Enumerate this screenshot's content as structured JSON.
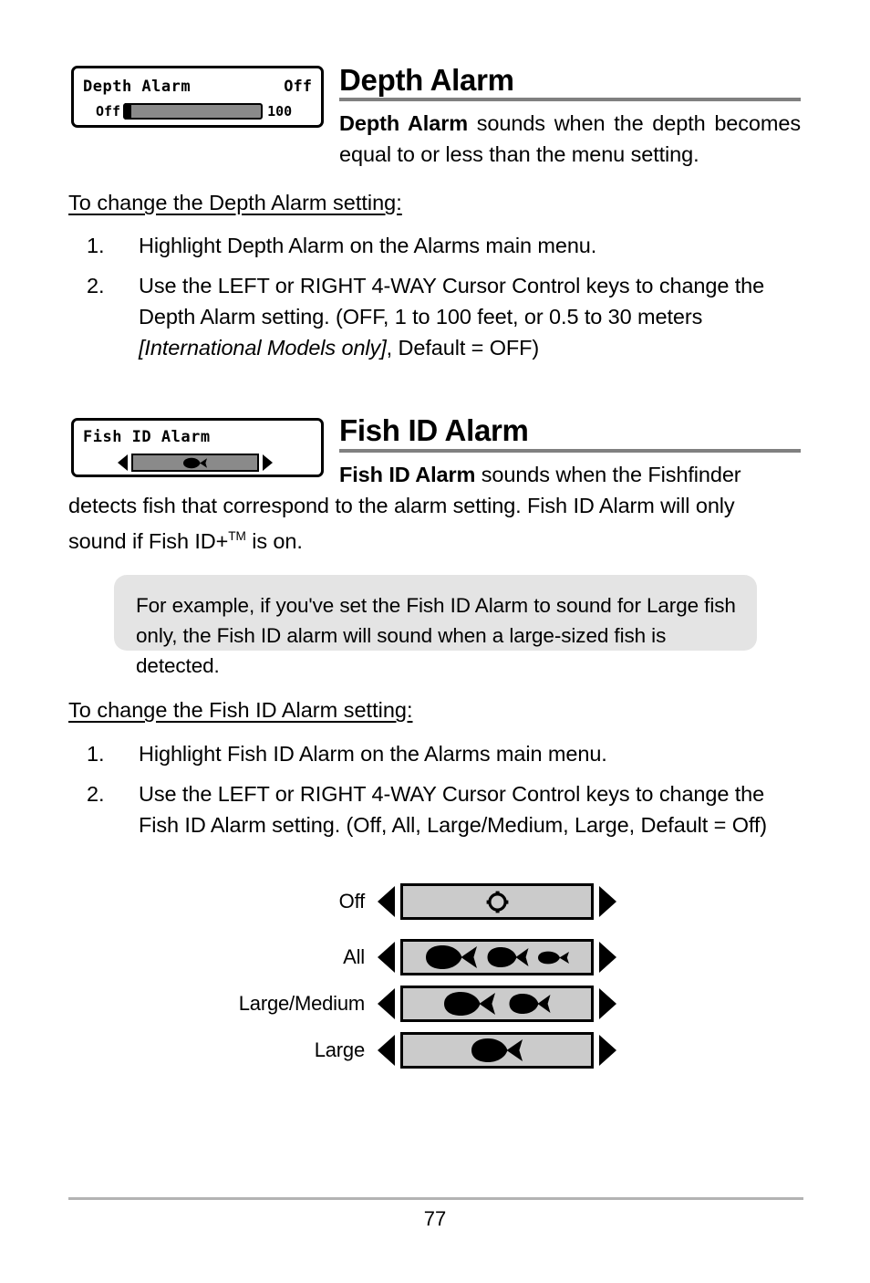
{
  "page": {
    "number": "77"
  },
  "sections": [
    {
      "id": "depth-alarm",
      "heading": "Depth Alarm",
      "intro_bold": "Depth Alarm",
      "intro_rest": " sounds when the depth becomes equal to or less than the menu setting.",
      "subhead": "To change the Depth Alarm setting:",
      "steps": [
        {
          "num": "1.",
          "text": "Highlight Depth Alarm on the Alarms main menu."
        },
        {
          "num": "2.",
          "text": "Use the LEFT or RIGHT 4-WAY Cursor Control keys to change the Depth Alarm setting. (OFF, 1 to 100 feet, or 0.5 to 30 meters ",
          "italic": "[International Models only]",
          "text_after": ", Default = OFF)"
        }
      ]
    },
    {
      "id": "fish-id-alarm",
      "heading": "Fish ID Alarm",
      "intro_bold": "Fish ID Alarm",
      "intro_rest": " sounds when the Fishfinder detects fish that correspond to the alarm setting. Fish ID Alarm will only sound if Fish ID+",
      "intro_tm": "TM",
      "intro_tail": " is on.",
      "subhead": "To change the Fish ID Alarm setting:",
      "steps": [
        {
          "num": "1.",
          "text": "Highlight Fish ID Alarm on the Alarms main menu."
        },
        {
          "num": "2.",
          "text": "Use the LEFT or RIGHT 4-WAY Cursor Control keys to change the Fish ID Alarm setting. (Off, All, Large/Medium, Large, Default = Off)"
        }
      ]
    }
  ],
  "callout": {
    "text": "For example, if you've set the Fish ID Alarm to sound for Large fish only, the Fish ID alarm will sound when a large-sized fish is detected."
  },
  "widgets": {
    "depth_alarm_lcd": {
      "title": "Depth Alarm",
      "value": "Off",
      "slider_min": "Off",
      "slider_max": "100",
      "slider_position_percent": 0
    },
    "fish_id_alarm_lcd": {
      "title": "Fish ID Alarm",
      "selected_icon": "fish-large-icon",
      "left_arrow": "left-arrow-icon",
      "right_arrow": "right-arrow-icon"
    }
  },
  "fish_options": [
    {
      "label": "Off",
      "icons": [
        "circle-outline-icon"
      ]
    },
    {
      "label": "All",
      "icons": [
        "fish-large-icon",
        "fish-medium-icon",
        "fish-small-icon"
      ]
    },
    {
      "label": "Large/Medium",
      "icons": [
        "fish-large-icon",
        "fish-medium-icon"
      ]
    },
    {
      "label": "Large",
      "icons": [
        "fish-large-icon"
      ]
    }
  ],
  "colors": {
    "rule": "#808080",
    "footer_rule": "#b3b3b3",
    "callout_bg": "#e4e4e4",
    "lcd_track": "#8a8a8a",
    "option_track": "#cbcbcb"
  }
}
